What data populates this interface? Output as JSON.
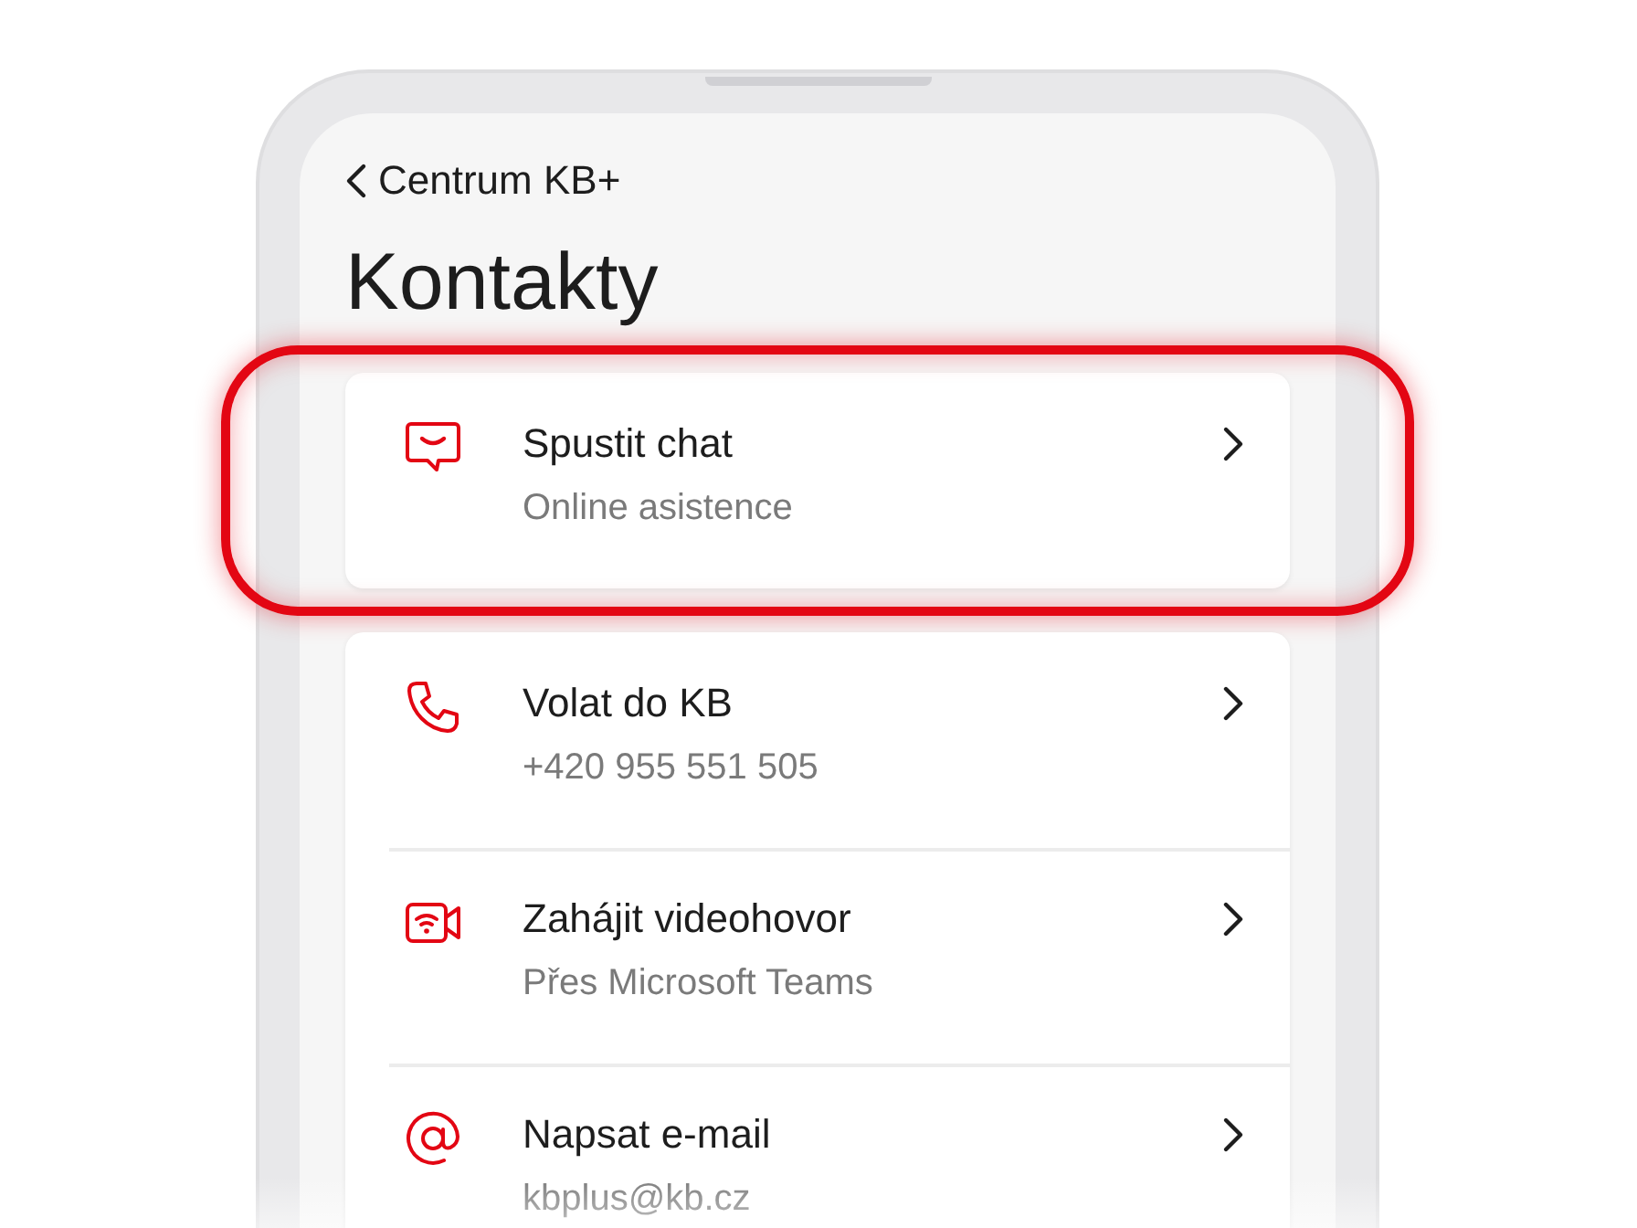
{
  "header": {
    "back_label": "Centrum KB+",
    "title": "Kontakty"
  },
  "groups": [
    {
      "items": [
        {
          "kind": "chat",
          "title": "Spustit chat",
          "subtitle": "Online asistence",
          "highlighted": true
        }
      ]
    },
    {
      "items": [
        {
          "kind": "phone",
          "title": "Volat do KB",
          "subtitle": "+420 955 551 505",
          "highlighted": false
        },
        {
          "kind": "video",
          "title": "Zahájit videohovor",
          "subtitle": "Přes Microsoft Teams",
          "highlighted": false
        },
        {
          "kind": "email",
          "title": "Napsat e-mail",
          "subtitle": "kbplus@kb.cz",
          "highlighted": false
        }
      ]
    }
  ]
}
